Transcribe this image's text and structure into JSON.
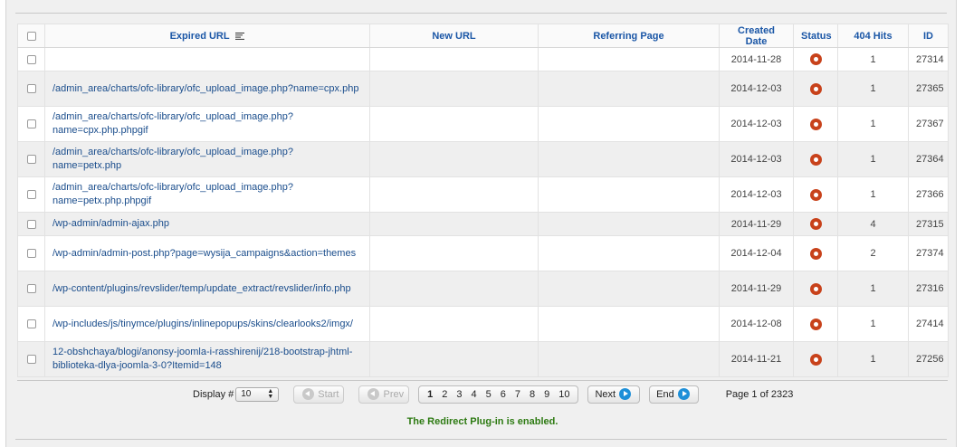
{
  "table": {
    "headers": {
      "expired_url": "Expired URL",
      "new_url": "New URL",
      "referring_page": "Referring Page",
      "created_date": "Created Date",
      "status": "Status",
      "hits": "404 Hits",
      "id": "ID"
    },
    "rows": [
      {
        "url": "",
        "new_url": "",
        "referring": "",
        "date": "2014-11-28",
        "status": "published",
        "hits": "1",
        "id": "27314"
      },
      {
        "url": "/admin_area/charts/ofc-library/ofc_upload_image.php?name=cpx.php",
        "new_url": "",
        "referring": "",
        "date": "2014-12-03",
        "status": "published",
        "hits": "1",
        "id": "27365"
      },
      {
        "url": "/admin_area/charts/ofc-library/ofc_upload_image.php?name=cpx.php.phpgif",
        "new_url": "",
        "referring": "",
        "date": "2014-12-03",
        "status": "published",
        "hits": "1",
        "id": "27367"
      },
      {
        "url": "/admin_area/charts/ofc-library/ofc_upload_image.php?name=petx.php",
        "new_url": "",
        "referring": "",
        "date": "2014-12-03",
        "status": "published",
        "hits": "1",
        "id": "27364"
      },
      {
        "url": "/admin_area/charts/ofc-library/ofc_upload_image.php?name=petx.php.phpgif",
        "new_url": "",
        "referring": "",
        "date": "2014-12-03",
        "status": "published",
        "hits": "1",
        "id": "27366"
      },
      {
        "url": "/wp-admin/admin-ajax.php",
        "new_url": "",
        "referring": "",
        "date": "2014-11-29",
        "status": "published",
        "hits": "4",
        "id": "27315"
      },
      {
        "url": "/wp-admin/admin-post.php?page=wysija_campaigns&action=themes",
        "new_url": "",
        "referring": "",
        "date": "2014-12-04",
        "status": "published",
        "hits": "2",
        "id": "27374"
      },
      {
        "url": "/wp-content/plugins/revslider/temp/update_extract/revslider/info.php",
        "new_url": "",
        "referring": "",
        "date": "2014-11-29",
        "status": "published",
        "hits": "1",
        "id": "27316"
      },
      {
        "url": "/wp-includes/js/tinymce/plugins/inlinepopups/skins/clearlooks2/imgx/",
        "new_url": "",
        "referring": "",
        "date": "2014-12-08",
        "status": "published",
        "hits": "1",
        "id": "27414"
      },
      {
        "url": "12-obshchaya/blogi/anonsy-joomla-i-rasshirenij/218-bootstrap-jhtml-biblioteka-dlya-joomla-3-0?Itemid=148",
        "new_url": "",
        "referring": "",
        "date": "2014-11-21",
        "status": "published",
        "hits": "1",
        "id": "27256"
      }
    ]
  },
  "pagination": {
    "display_label": "Display #",
    "display_value": "10",
    "start": "Start",
    "prev": "Prev",
    "pages": [
      "1",
      "2",
      "3",
      "4",
      "5",
      "6",
      "7",
      "8",
      "9",
      "10"
    ],
    "current_page": "1",
    "next": "Next",
    "end": "End",
    "page_info": "Page 1 of 2323"
  },
  "message": "The Redirect Plug-in is enabled.",
  "colors": {
    "link": "#1a4d8c",
    "header": "#1a56a6",
    "status_published": "#c8421b",
    "success": "#2d7a12",
    "nav_icon": "#1e8fd8"
  }
}
